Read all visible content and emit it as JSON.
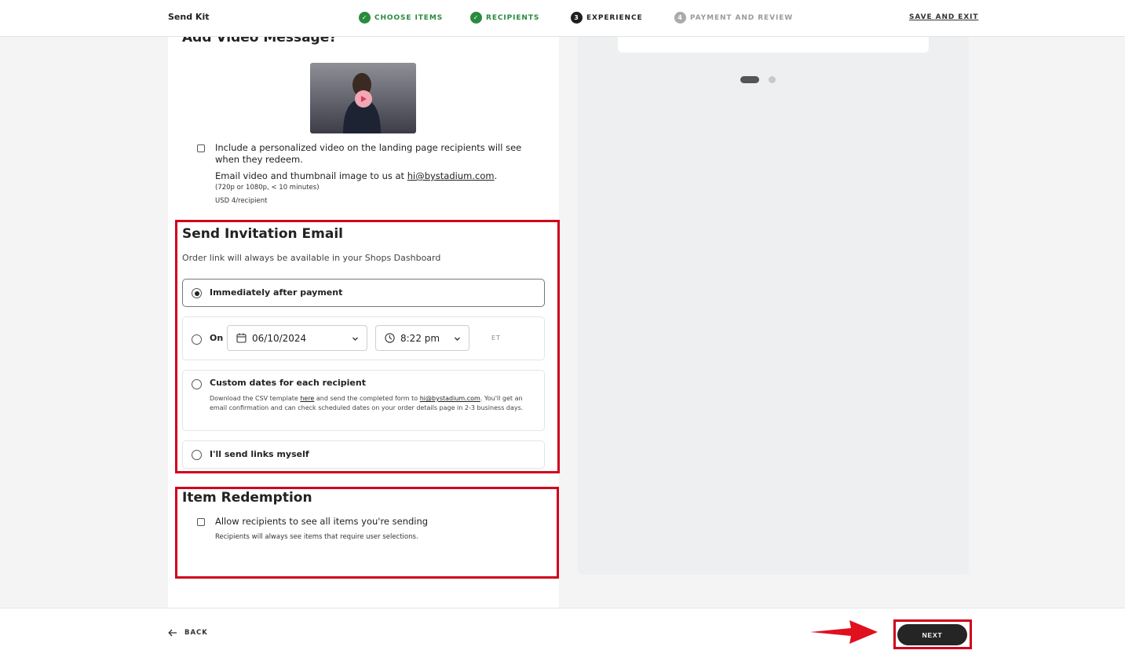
{
  "header": {
    "brand": "Send Kit",
    "steps": [
      {
        "label": "CHOOSE ITEMS",
        "marker": "✓",
        "state": "done"
      },
      {
        "label": "RECIPIENTS",
        "marker": "✓",
        "state": "done"
      },
      {
        "label": "EXPERIENCE",
        "marker": "3",
        "state": "active"
      },
      {
        "label": "PAYMENT AND REVIEW",
        "marker": "4",
        "state": "todo"
      }
    ],
    "save_exit": "SAVE AND EXIT"
  },
  "video": {
    "title": "Add Video Message?",
    "checkbox_label": "Include a personalized video on the landing page recipients will see when they redeem.",
    "email_prefix": "Email video and thumbnail image to us at ",
    "email": "hi@bystadium.com",
    "email_suffix": ".",
    "specs": "(720p or 1080p, < 10 minutes)",
    "price": "USD 4/recipient"
  },
  "invitation": {
    "title": "Send Invitation Email",
    "subtitle": "Order link will always be available in your Shops Dashboard",
    "options": {
      "immediate": "Immediately after payment",
      "on": "On",
      "date": "06/10/2024",
      "time": "8:22 pm",
      "tz": "ET",
      "custom": "Custom dates for each recipient",
      "custom_desc_1": "Download the CSV template ",
      "custom_link_here": "here",
      "custom_desc_2": " and send the completed form to ",
      "custom_email": "hi@bystadium.com",
      "custom_desc_3": ". You'll get an email confirmation and can check scheduled dates on your order details page in 2-3 business days.",
      "self": "I'll send links myself"
    },
    "selected": "immediate"
  },
  "redemption": {
    "title": "Item Redemption",
    "checkbox_label": "Allow recipients to see all items you're sending",
    "note": "Recipients will always see items that require user selections."
  },
  "footer": {
    "back": "BACK",
    "next": "NEXT"
  },
  "colors": {
    "accent_green": "#2a8a3e",
    "highlight_red": "#d0021b",
    "dark_button": "#252525"
  },
  "icons": {
    "step_done": "check-circle-icon",
    "calendar": "calendar-icon",
    "clock": "clock-icon",
    "back": "arrow-left-icon",
    "play": "play-icon"
  }
}
